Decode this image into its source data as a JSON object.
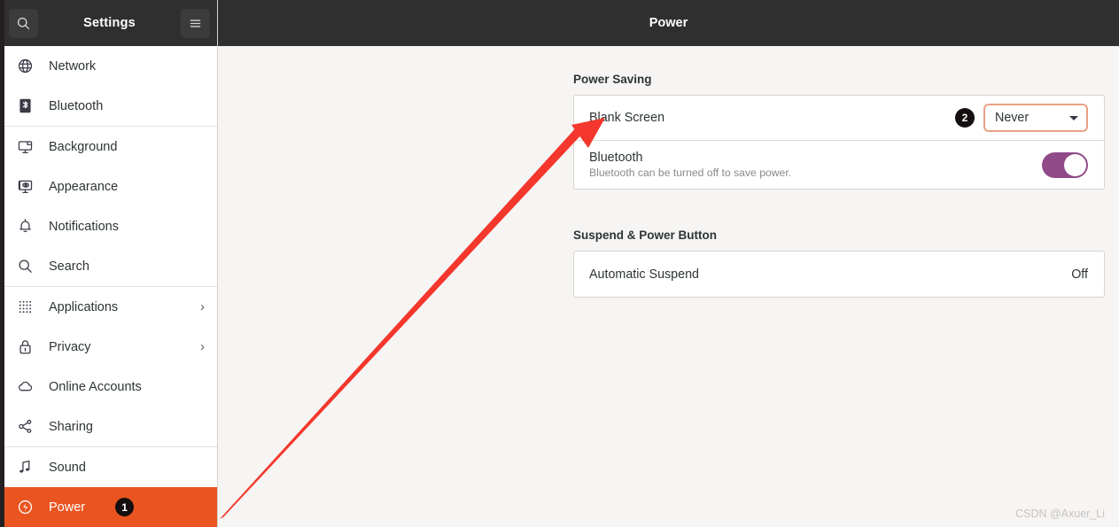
{
  "window": {
    "sidebar_title": "Settings",
    "main_title": "Power"
  },
  "sidebar": {
    "search_icon": "search-icon",
    "menu_icon": "hamburger-menu-icon",
    "items": [
      {
        "label": "Network",
        "icon": "globe-icon",
        "chevron": "",
        "badge": "",
        "selected": false,
        "sep_after": false
      },
      {
        "label": "Bluetooth",
        "icon": "bluetooth-icon",
        "chevron": "",
        "badge": "",
        "selected": false,
        "sep_after": true
      },
      {
        "label": "Background",
        "icon": "monitor-icon",
        "chevron": "",
        "badge": "",
        "selected": false,
        "sep_after": false
      },
      {
        "label": "Appearance",
        "icon": "appearance-icon",
        "chevron": "",
        "badge": "",
        "selected": false,
        "sep_after": false
      },
      {
        "label": "Notifications",
        "icon": "bell-icon",
        "chevron": "",
        "badge": "",
        "selected": false,
        "sep_after": false
      },
      {
        "label": "Search",
        "icon": "search-icon",
        "chevron": "",
        "badge": "",
        "selected": false,
        "sep_after": true
      },
      {
        "label": "Applications",
        "icon": "grid-dots-icon",
        "chevron": "›",
        "badge": "",
        "selected": false,
        "sep_after": false
      },
      {
        "label": "Privacy",
        "icon": "lock-icon",
        "chevron": "›",
        "badge": "",
        "selected": false,
        "sep_after": false
      },
      {
        "label": "Online Accounts",
        "icon": "cloud-icon",
        "chevron": "",
        "badge": "",
        "selected": false,
        "sep_after": false
      },
      {
        "label": "Sharing",
        "icon": "share-nodes-icon",
        "chevron": "",
        "badge": "",
        "selected": false,
        "sep_after": true
      },
      {
        "label": "Sound",
        "icon": "music-note-icon",
        "chevron": "",
        "badge": "",
        "selected": false,
        "sep_after": false
      },
      {
        "label": "Power",
        "icon": "power-icon",
        "chevron": "",
        "badge": "1",
        "selected": true,
        "sep_after": false
      }
    ]
  },
  "main": {
    "sections": [
      {
        "title": "Power Saving",
        "rows": [
          {
            "label": "Blank Screen",
            "sub": "",
            "control": "dropdown",
            "value": "Never",
            "badge": "2"
          },
          {
            "label": "Bluetooth",
            "sub": "Bluetooth can be turned off to save power.",
            "control": "toggle",
            "value": "on",
            "badge": ""
          }
        ]
      },
      {
        "title": "Suspend & Power Button",
        "rows": [
          {
            "label": "Automatic Suspend",
            "sub": "",
            "control": "text",
            "value": "Off",
            "badge": ""
          }
        ]
      }
    ]
  },
  "annotations": {
    "arrow_color": "#f4372c",
    "watermark": "CSDN @Axuer_Li"
  },
  "colors": {
    "accent_orange": "#e95420",
    "toggle_purple": "#904a87",
    "focus_border": "#eaa183",
    "header_dark": "#2f2f2f",
    "content_bg": "#f6f5f4"
  }
}
